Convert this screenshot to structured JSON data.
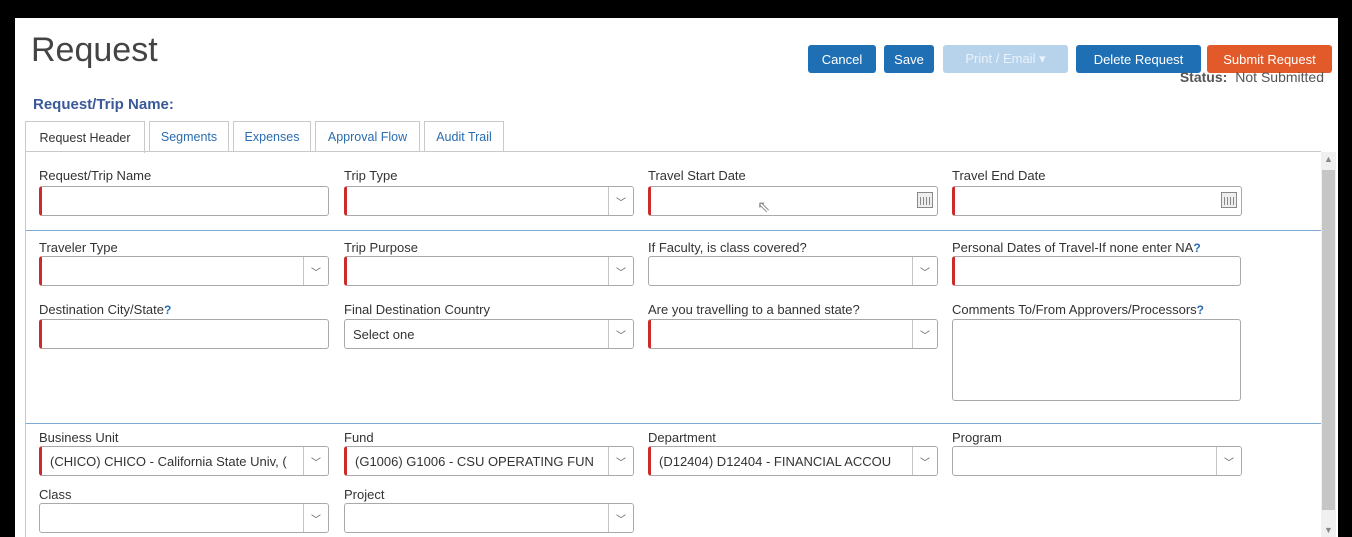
{
  "header": {
    "title": "Request",
    "buttons": {
      "cancel": "Cancel",
      "save": "Save",
      "print_email": "Print / Email ▾",
      "delete": "Delete Request",
      "submit": "Submit Request"
    },
    "status_label": "Status:",
    "status_value": "Not Submitted",
    "trip_name_label": "Request/Trip Name:"
  },
  "tabs": [
    "Request Header",
    "Segments",
    "Expenses",
    "Approval Flow",
    "Audit Trail"
  ],
  "form": {
    "request_trip_name": {
      "label": "Request/Trip Name",
      "value": ""
    },
    "trip_type": {
      "label": "Trip Type",
      "value": ""
    },
    "travel_start_date": {
      "label": "Travel Start Date",
      "value": ""
    },
    "travel_end_date": {
      "label": "Travel End Date",
      "value": ""
    },
    "traveler_type": {
      "label": "Traveler Type",
      "value": ""
    },
    "trip_purpose": {
      "label": "Trip Purpose",
      "value": ""
    },
    "faculty_class_covered": {
      "label": "If Faculty, is class covered?",
      "value": ""
    },
    "personal_dates": {
      "label": "Personal Dates of Travel-If none enter NA",
      "value": ""
    },
    "destination_city_state": {
      "label": "Destination City/State",
      "value": ""
    },
    "final_destination_country": {
      "label": "Final Destination Country",
      "value": "Select one"
    },
    "banned_state": {
      "label": "Are you travelling to a banned state?",
      "value": ""
    },
    "comments": {
      "label": "Comments To/From Approvers/Processors",
      "value": ""
    },
    "business_unit": {
      "label": "Business Unit",
      "value": "(CHICO) CHICO - California State Univ, ("
    },
    "fund": {
      "label": "Fund",
      "value": "(G1006) G1006 - CSU OPERATING FUN"
    },
    "department": {
      "label": "Department",
      "value": "(D12404) D12404 - FINANCIAL ACCOU"
    },
    "program": {
      "label": "Program",
      "value": ""
    },
    "class": {
      "label": "Class",
      "value": ""
    },
    "project": {
      "label": "Project",
      "value": ""
    }
  },
  "help_marker": "?",
  "colors": {
    "primary": "#1f6fb5",
    "submit": "#e2592a",
    "required": "#cc2b2b",
    "divider": "#7eaad6"
  }
}
